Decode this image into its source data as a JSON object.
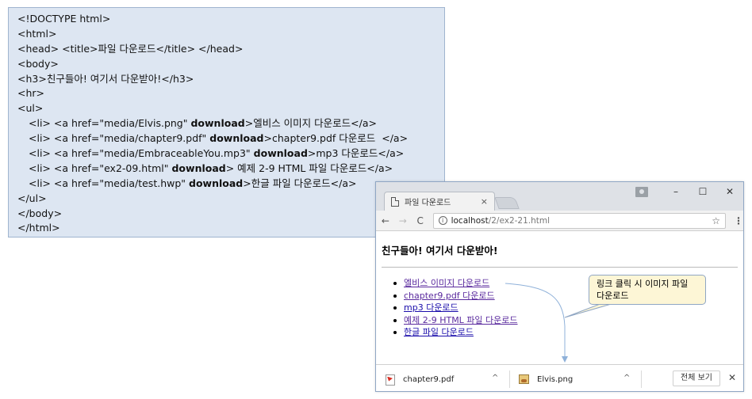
{
  "code": {
    "lines": [
      "<!DOCTYPE html>",
      "<html>",
      "<head> <title>파일 다운로드</title> </head>",
      "<body>",
      "<h3>친구들아! 여기서 다운받아!</h3>",
      "<hr>",
      "<ul>"
    ],
    "items": [
      {
        "pre": "<li> <a href=\"media/Elvis.png\" ",
        "kw": "download",
        "post": ">엘비스 이미지 다운로드</a>"
      },
      {
        "pre": "<li> <a href=\"media/chapter9.pdf\" ",
        "kw": "download",
        "post": ">chapter9.pdf 다운로드  </a>"
      },
      {
        "pre": "<li> <a href=\"media/EmbraceableYou.mp3\" ",
        "kw": "download",
        "post": ">mp3 다운로드</a>"
      },
      {
        "pre": "<li> <a href=\"ex2-09.html\" ",
        "kw": "download",
        "post": "> 예제 2-9 HTML 파일 다운로드</a>"
      },
      {
        "pre": "<li> <a href=\"media/test.hwp\" ",
        "kw": "download",
        "post": ">한글 파일 다운로드</a>"
      }
    ],
    "closing": [
      "</ul>",
      "</body>",
      "</html>"
    ]
  },
  "browser": {
    "tab_title": "파일 다운로드",
    "tab_close": "×",
    "controls": {
      "minimize": "–",
      "maximize": "☐",
      "close": "✕"
    },
    "nav": {
      "back": "←",
      "forward": "→",
      "reload": "C"
    },
    "url_host": "localhost",
    "url_path": "/2/ex2-21.html",
    "star": "☆",
    "menu": "⋮",
    "page": {
      "heading": "친구들아! 여기서 다운받아!",
      "links": [
        "엘비스 이미지 다운로드",
        "chapter9.pdf 다운로드",
        "mp3 다운로드",
        "예제 2-9 HTML 파일 다운로드",
        "한글 파일 다운로드"
      ]
    },
    "callout": "링크 클릭 시 이미지 파일 다운로드",
    "downloads": [
      {
        "name": "chapter9.pdf",
        "icon": "pdf-file-icon"
      },
      {
        "name": "Elvis.png",
        "icon": "image-file-icon"
      }
    ],
    "caret": "^",
    "show_all": "전체 보기",
    "shelf_close": "✕"
  },
  "colors": {
    "code_bg": "#dde6f2",
    "link": "#1a0dab",
    "visited": "#5a2a9e",
    "callout_bg": "#fdf6d6",
    "arrow": "#8fb1d9"
  }
}
